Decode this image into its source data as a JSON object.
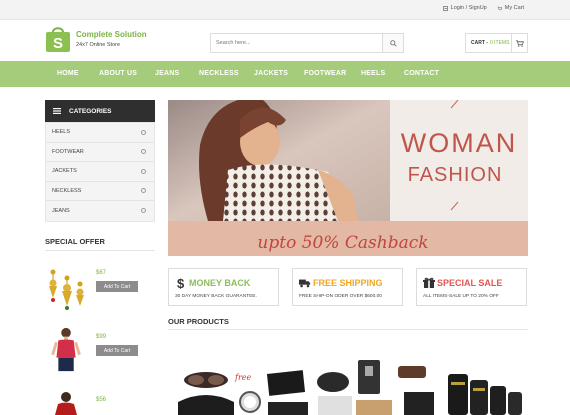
{
  "topbar": {
    "login_label": "Login / SignUp",
    "cart_label": "My Cart"
  },
  "brand": {
    "name": "Complete Solution",
    "tagline": "24x7 Online Store",
    "logo_letter": "S"
  },
  "search": {
    "placeholder": "Search here..."
  },
  "cart": {
    "label": "CART -",
    "items": "0 ITEMS"
  },
  "nav": {
    "items": [
      "HOME",
      "ABOUT US",
      "JEANS",
      "NECKLESS",
      "JACKETS",
      "FOOTWEAR",
      "HEELS",
      "CONTACT"
    ]
  },
  "sidebar": {
    "categories_title": "CATEGORIES",
    "categories": [
      "HEELS",
      "FOOTWEAR",
      "JACKETS",
      "NECKLESS",
      "JEANS"
    ],
    "special_offer_title": "SPECIAL OFFER",
    "offers": [
      {
        "price": "$67",
        "button": "Add To Cart",
        "icon": "earrings-image"
      },
      {
        "price": "$99",
        "button": "Add To Cart",
        "icon": "red-top-image"
      },
      {
        "price": "$56",
        "button": "Add To Cart",
        "icon": "red-dress-image"
      }
    ]
  },
  "banner": {
    "line1": "WOMAN",
    "line2": "FASHION",
    "cashback": "upto 50% Cashback"
  },
  "features": [
    {
      "title": "MONEY BACK",
      "subtitle": "30 DAY MONEY BACK GUARANTEE.",
      "icon": "dollar-icon",
      "color": "#8cbd5a"
    },
    {
      "title": "FREE SHIPPING",
      "subtitle": "FREE SHIP-ON ODER OVER $600.00",
      "icon": "truck-icon",
      "color": "#f2a623"
    },
    {
      "title": "SPECIAL SALE",
      "subtitle": "ALL ITEMS-SALE UP TO 20% OFF",
      "icon": "gift-icon",
      "color": "#e2554f"
    }
  ],
  "products": {
    "title": "OUR PRODUCTS",
    "free_label": "free"
  },
  "colors": {
    "accent": "#7cb342",
    "nav_bg": "#a5cc7a",
    "dark": "#2f2f2f",
    "cashback_bg": "#e3b8a4",
    "cashback_text": "#c0463f"
  }
}
